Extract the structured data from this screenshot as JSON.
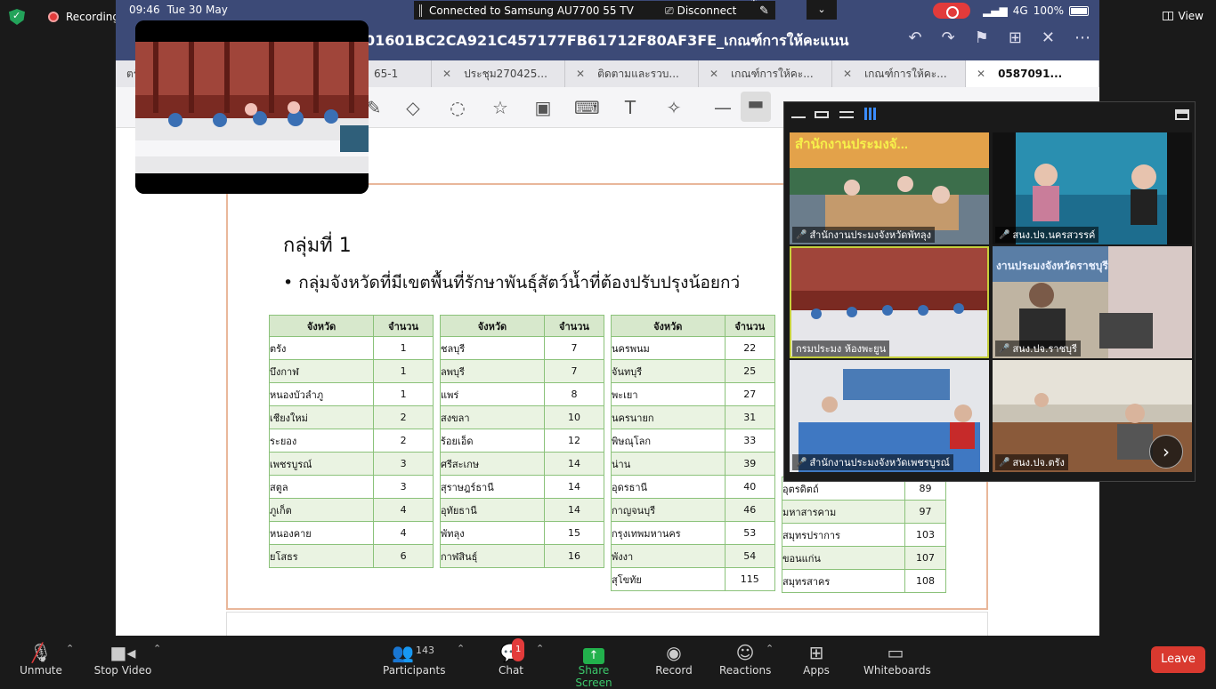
{
  "zoom_top": {
    "recording_label": "Recording",
    "view_label": "View"
  },
  "tablet_status": {
    "time": "09:46",
    "date": "Tue 30 May",
    "cast_text": "Connected to Samsung AU7700 55 TV",
    "disconnect_label": "Disconnect",
    "signal": "4G",
    "battery": "100%"
  },
  "doc": {
    "title": "01601BC2CA921C457177FB61712F80AF3FE_เกณฑ์การให้คะแนน"
  },
  "tabs": [
    {
      "label": "ตรัง"
    },
    {
      "label": "65-1"
    },
    {
      "label": "ประชุม270425..."
    },
    {
      "label": "ติดตามและรวบ..."
    },
    {
      "label": "เกณฑ์การให้คะ..."
    },
    {
      "label": "เกณฑ์การให้คะ..."
    },
    {
      "label": "0587091..."
    }
  ],
  "slide": {
    "title": "กลุ่มที่ 1",
    "bullet": "• กลุ่มจังหวัดที่มีเขตพื้นที่รักษาพันธุ์สัตว์น้ำที่ต้องปรับปรุงน้อยกว่"
  },
  "tables": {
    "header_province": "จังหวัด",
    "header_count": "จำนวน",
    "t1": [
      [
        "ตรัง",
        "1"
      ],
      [
        "บึงกาฬ",
        "1"
      ],
      [
        "หนองบัวลำภู",
        "1"
      ],
      [
        "เชียงใหม่",
        "2"
      ],
      [
        "ระยอง",
        "2"
      ],
      [
        "เพชรบูรณ์",
        "3"
      ],
      [
        "สตูล",
        "3"
      ],
      [
        "ภูเก็ต",
        "4"
      ],
      [
        "หนองคาย",
        "4"
      ],
      [
        "ยโสธร",
        "6"
      ]
    ],
    "t2": [
      [
        "ชลบุรี",
        "7"
      ],
      [
        "ลพบุรี",
        "7"
      ],
      [
        "แพร่",
        "8"
      ],
      [
        "สงขลา",
        "10"
      ],
      [
        "ร้อยเอ็ด",
        "12"
      ],
      [
        "ศรีสะเกษ",
        "14"
      ],
      [
        "สุราษฎร์ธานี",
        "14"
      ],
      [
        "อุทัยธานี",
        "14"
      ],
      [
        "พัทลุง",
        "15"
      ],
      [
        "กาฬสินธุ์",
        "16"
      ]
    ],
    "t3": [
      [
        "นครพนม",
        "22"
      ],
      [
        "จันทบุรี",
        "25"
      ],
      [
        "พะเยา",
        "27"
      ],
      [
        "นครนายก",
        "31"
      ],
      [
        "พิษณุโลก",
        "33"
      ],
      [
        "น่าน",
        "39"
      ],
      [
        "อุดรธานี",
        "40"
      ],
      [
        "กาญจนบุรี",
        "46"
      ],
      [
        "กรุงเทพมหานคร",
        "53"
      ],
      [
        "พังงา",
        "54"
      ],
      [
        "สุโขทัย",
        "115"
      ]
    ],
    "t4": [
      [
        "อุตรดิตถ์",
        "89"
      ],
      [
        "มหาสารคาม",
        "97"
      ],
      [
        "สมุทรปราการ",
        "103"
      ],
      [
        "ขอนแก่น",
        "107"
      ],
      [
        "สมุทรสาคร",
        "108"
      ]
    ]
  },
  "gallery": {
    "tiles": [
      {
        "label": "สำนักงานประมงจังหวัดพัทลุง"
      },
      {
        "label": "สนง.ปจ.นครสวรรค์"
      },
      {
        "label": "กรมประมง ห้องพะยูน"
      },
      {
        "label": "สนง.ปจ.ราชบุรี"
      },
      {
        "label": "สำนักงานประมงจังหวัดเพชรบูรณ์"
      },
      {
        "label": "สนง.ปจ.ตรัง"
      }
    ],
    "overlay_text_1": "สำนักงานประมงจั...",
    "overlay_text_2": "งานประมงจังหวัดราชบุรี"
  },
  "bottom": {
    "unmute": "Unmute",
    "stop_video": "Stop Video",
    "participants": "Participants",
    "participants_count": "143",
    "chat": "Chat",
    "chat_badge": "1",
    "share": "Share Screen",
    "record": "Record",
    "reactions": "Reactions",
    "apps": "Apps",
    "whiteboards": "Whiteboards",
    "leave": "Leave"
  }
}
